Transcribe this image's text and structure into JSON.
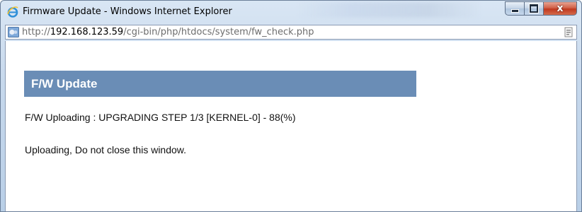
{
  "window": {
    "title": "Firmware Update - Windows Internet Explorer",
    "controls": {
      "minimize_icon": "minimize-icon",
      "maximize_icon": "maximize-icon",
      "close_label": "x"
    }
  },
  "address_bar": {
    "prefix": "http://",
    "host": "192.168.123.59",
    "path": "/cgi-bin/php/htdocs/system/fw_check.php"
  },
  "page": {
    "header_title": "F/W Update",
    "status_text": "F/W Uploading : UPGRADING STEP 1/3 [KERNEL-0] - 88(%)",
    "warning_text": "Uploading, Do not close this window."
  },
  "colors": {
    "header_bar": "#6a8db6",
    "close_button": "#c0391f"
  }
}
